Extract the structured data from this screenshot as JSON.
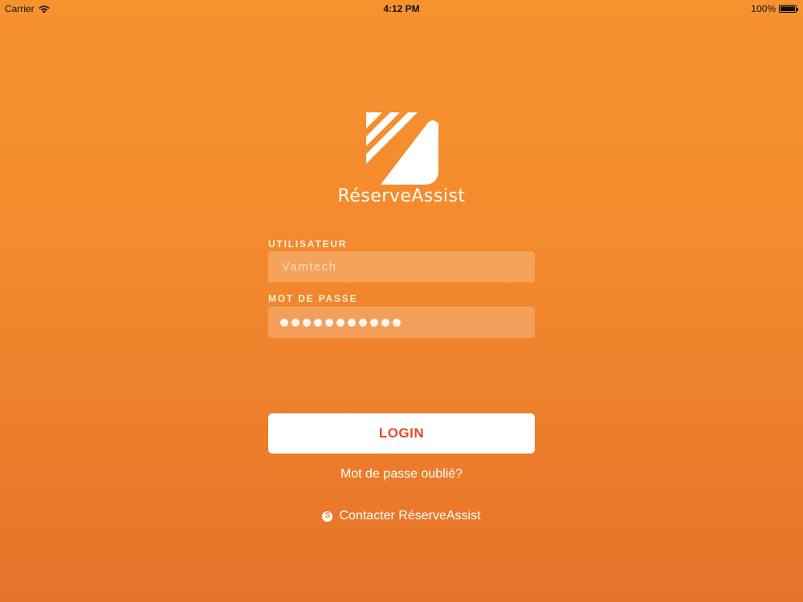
{
  "status_bar": {
    "carrier": "Carrier",
    "time": "4:12 PM",
    "battery": "100%",
    "battery_level": 1.0
  },
  "brand": {
    "name": "RéserveAssist",
    "logo_icon": "reserveassist-logo-icon"
  },
  "form": {
    "username_label": "UTILISATEUR",
    "username_placeholder": "Vamtech",
    "username_value": "",
    "password_label": "MOT DE PASSE",
    "password_length": 11
  },
  "actions": {
    "login_label": "LOGIN",
    "forgot_label": "Mot de passe oublié?",
    "contact_label": "Contacter RéserveAssist",
    "contact_icon": "skype-icon",
    "contact_icon_glyph": "S"
  },
  "colors": {
    "background_top": "#f7922f",
    "background_bottom": "#e6722a",
    "login_text": "#e6492a",
    "white": "#ffffff"
  }
}
